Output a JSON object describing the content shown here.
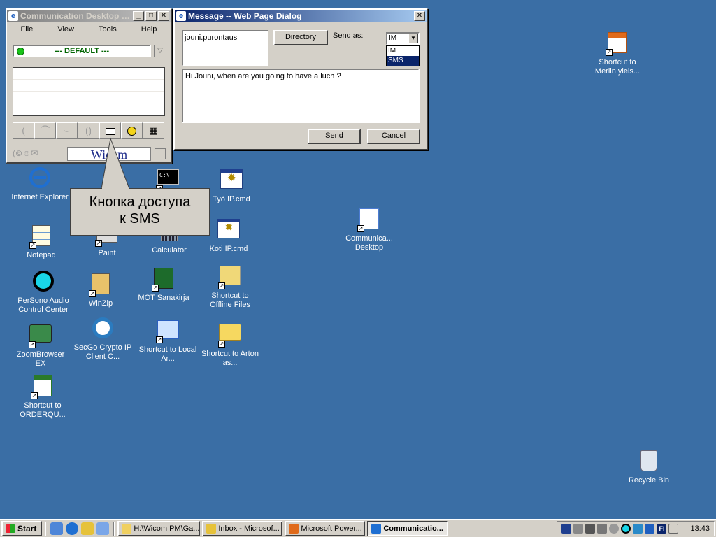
{
  "comm_window": {
    "title": "Communication Desktop - ...",
    "menu": [
      "File",
      "View",
      "Tools",
      "Help"
    ],
    "profile": "--- DEFAULT ---",
    "brand": "Wicom"
  },
  "message_dialog": {
    "title": "Message -- Web Page Dialog",
    "recipient": "jouni.purontaus",
    "directory_label": "Directory",
    "send_as_label": "Send as:",
    "send_as_value": "IM",
    "send_as_options": [
      "IM",
      "SMS"
    ],
    "message_text": "Hi Jouni, when are you going to have a luch ?",
    "send_label": "Send",
    "cancel_label": "Cancel"
  },
  "callout": {
    "line1": "Кнопка доступа",
    "line2": "к SMS"
  },
  "desktop_icons": {
    "ie": "Internet Explorer",
    "notepad": "Notepad",
    "persono": "PerSono Audio Control Center",
    "zoombrowser": "ZoomBrowser EX",
    "orderqu": "Shortcut to ORDERQU...",
    "paint": "Paint",
    "winzip": "WinZip",
    "secgo": "SecGo Crypto IP Client C...",
    "calculator": "Calculator",
    "mot": "MOT Sanakirja",
    "local_ar": "Shortcut to Local Ar...",
    "tyo_ip": "Työ IP.cmd",
    "koti_ip": "Koti IP.cmd",
    "offline": "Shortcut to Offline Files",
    "arton": "Shortcut to Arton as...",
    "comm_desktop": "Communica... Desktop",
    "merlin": "Shortcut to Merlin yleis...",
    "recycle": "Recycle Bin"
  },
  "taskbar": {
    "start": "Start",
    "tasks": [
      "H:\\Wicom PM\\Ga...",
      "Inbox - Microsof...",
      "Microsoft Power...",
      "Communicatio..."
    ],
    "language": "FI",
    "clock": "13:43"
  },
  "colors": {
    "desktop": "#3a6ea5",
    "title_active": "#0a246a",
    "status_green": "#19c319"
  }
}
